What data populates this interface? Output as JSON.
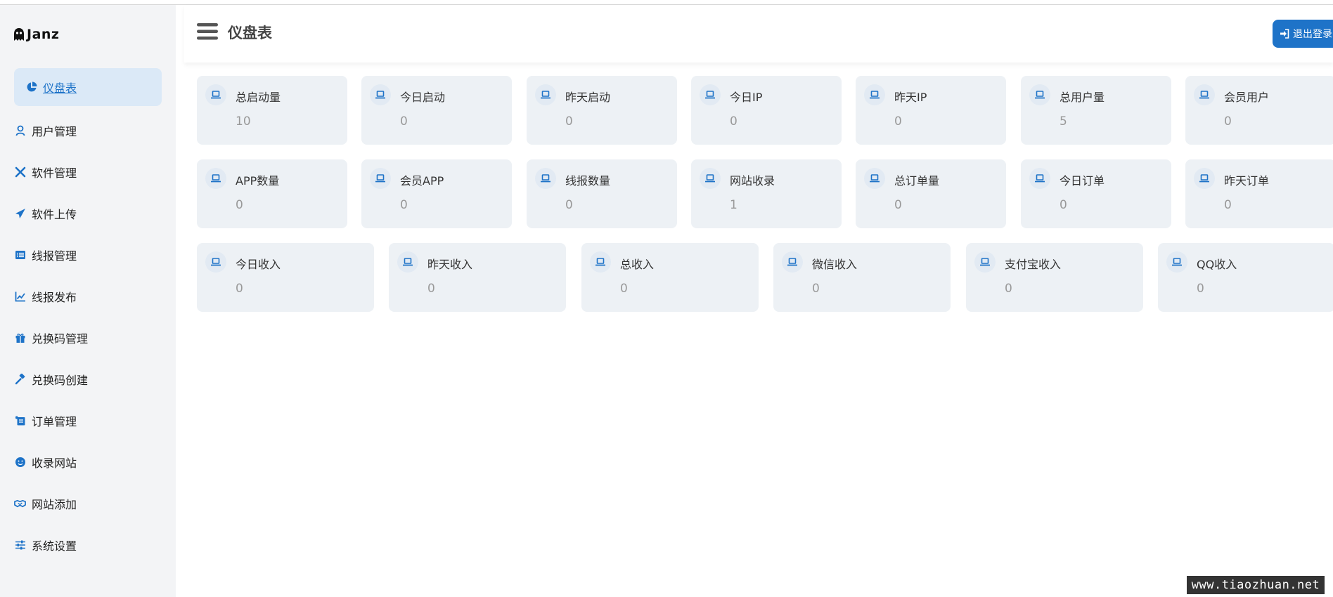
{
  "brand": {
    "name": "Janz"
  },
  "header": {
    "title": "仪盘表",
    "logout_label": "退出登录"
  },
  "sidebar": {
    "items": [
      {
        "label": "仪盘表",
        "icon": "pie-chart-icon",
        "active": true
      },
      {
        "label": "用户管理",
        "icon": "user-badge-icon"
      },
      {
        "label": "软件管理",
        "icon": "tools-icon"
      },
      {
        "label": "软件上传",
        "icon": "paper-plane-icon"
      },
      {
        "label": "线报管理",
        "icon": "list-icon"
      },
      {
        "label": "线报发布",
        "icon": "chart-line-icon"
      },
      {
        "label": "兑换码管理",
        "icon": "gift-icon"
      },
      {
        "label": "兑换码创建",
        "icon": "hammer-icon"
      },
      {
        "label": "订单管理",
        "icon": "receipt-icon"
      },
      {
        "label": "收录网站",
        "icon": "smile-icon"
      },
      {
        "label": "网站添加",
        "icon": "handshake-icon"
      },
      {
        "label": "系统设置",
        "icon": "sliders-icon"
      }
    ]
  },
  "stats": {
    "row1": [
      {
        "label": "总启动量",
        "value": "10"
      },
      {
        "label": "今日启动",
        "value": "0"
      },
      {
        "label": "昨天启动",
        "value": "0"
      },
      {
        "label": "今日IP",
        "value": "0"
      },
      {
        "label": "昨天IP",
        "value": "0"
      },
      {
        "label": "总用户量",
        "value": "5"
      },
      {
        "label": "会员用户",
        "value": "0"
      }
    ],
    "row2": [
      {
        "label": "APP数量",
        "value": "0"
      },
      {
        "label": "会员APP",
        "value": "0"
      },
      {
        "label": "线报数量",
        "value": "0"
      },
      {
        "label": "网站收录",
        "value": "1"
      },
      {
        "label": "总订单量",
        "value": "0"
      },
      {
        "label": "今日订单",
        "value": "0"
      },
      {
        "label": "昨天订单",
        "value": "0"
      }
    ],
    "row3": [
      {
        "label": "今日收入",
        "value": "0"
      },
      {
        "label": "昨天收入",
        "value": "0"
      },
      {
        "label": "总收入",
        "value": "0"
      },
      {
        "label": "微信收入",
        "value": "0"
      },
      {
        "label": "支付宝收入",
        "value": "0"
      },
      {
        "label": "QQ收入",
        "value": "0"
      }
    ]
  },
  "card_icon": "laptop-icon",
  "colors": {
    "accent": "#1e73c8",
    "card_bg": "#edf1f5",
    "sidebar_bg": "#f3f4f6"
  },
  "watermark": "www.tiaozhuan.net"
}
